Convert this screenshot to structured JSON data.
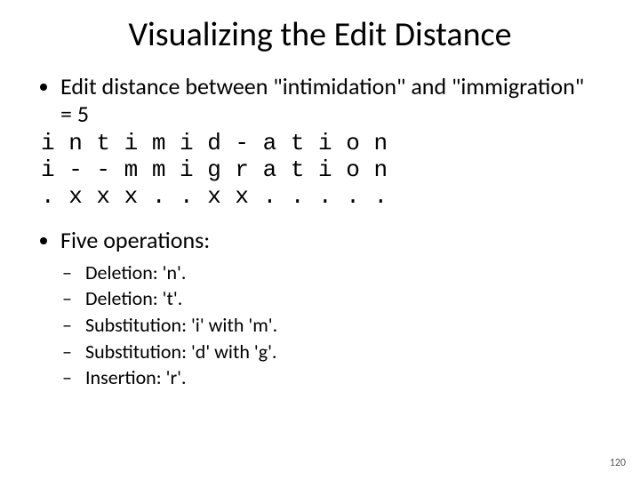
{
  "title": "Visualizing the Edit Distance",
  "bullet1": "Edit distance between \"intimidation\" and \"immigration\" = 5",
  "alignment": "i n t i m i d - a t i o n\ni - - m m i g r a t i o n\n. x x x . . x x . . . . .",
  "bullet2": "Five operations:",
  "ops": [
    "Deletion: 'n'.",
    "Deletion: 't'.",
    "Substitution: 'i' with 'm'.",
    "Substitution: 'd' with 'g'.",
    "Insertion: 'r'."
  ],
  "page_number": "120"
}
